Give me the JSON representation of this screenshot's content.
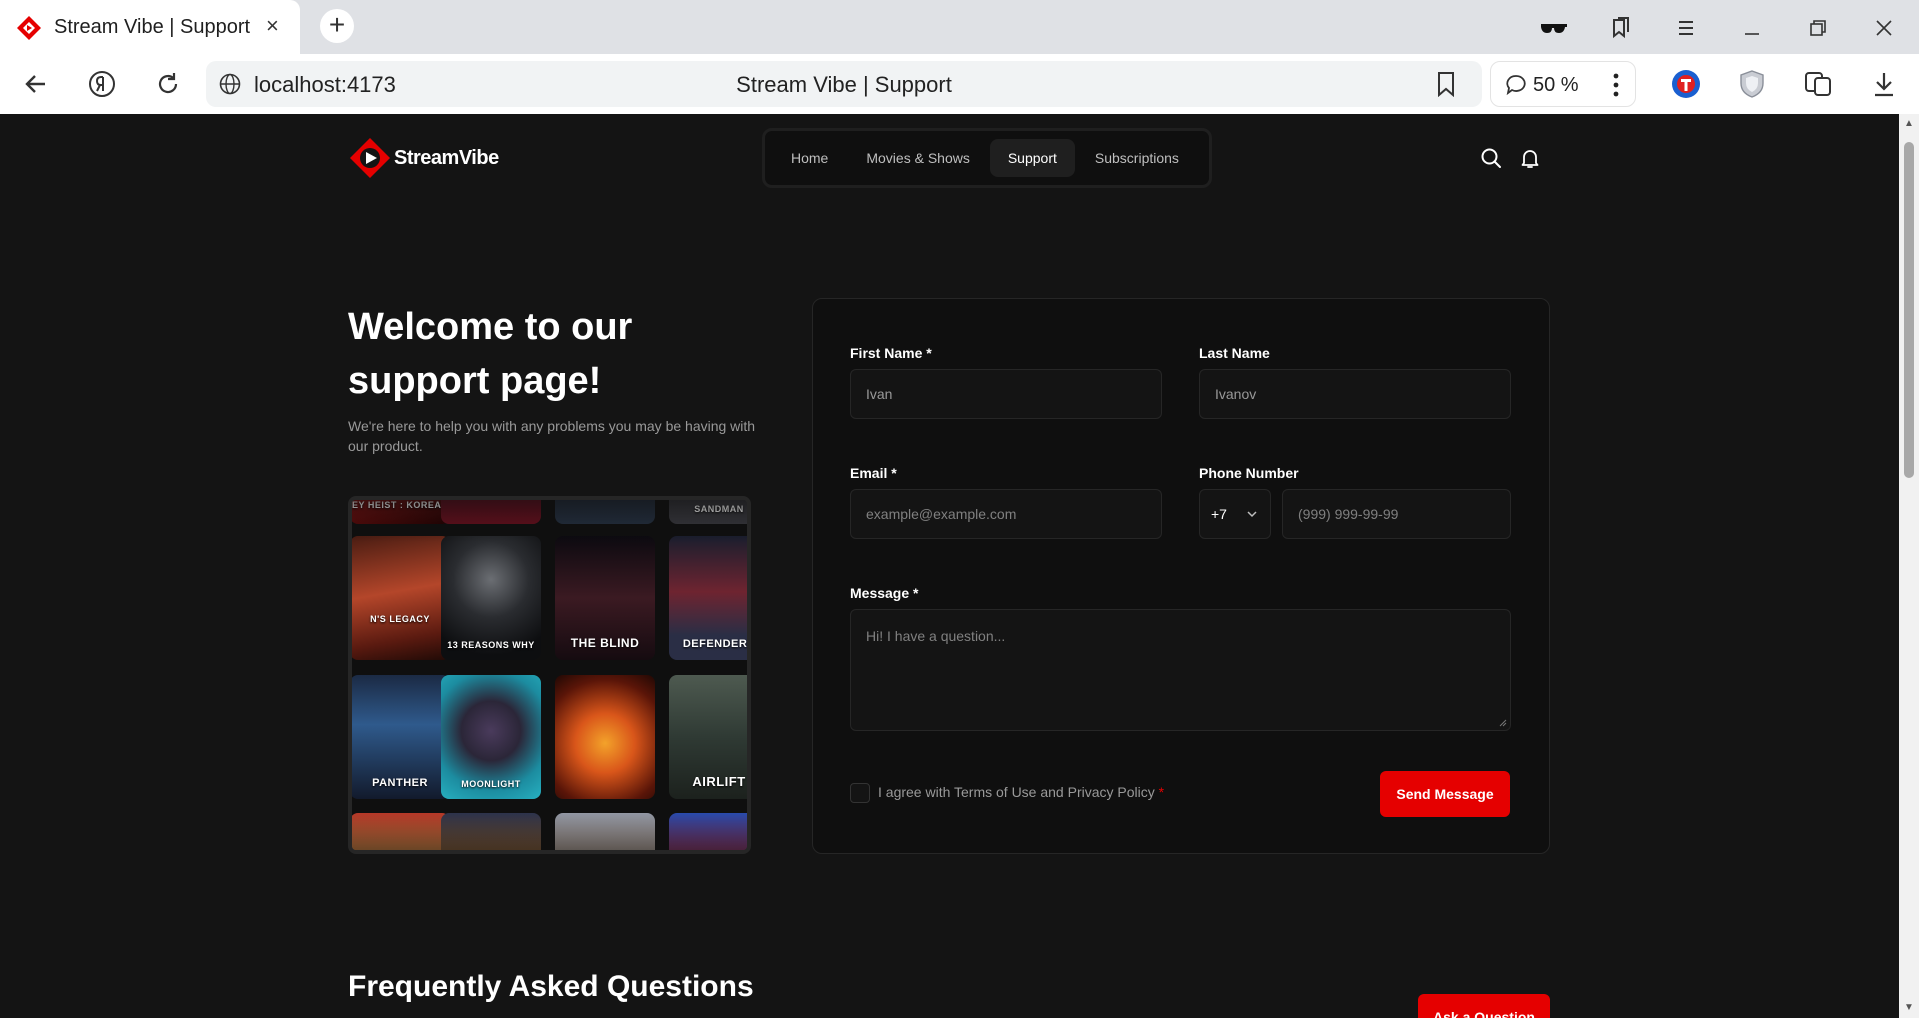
{
  "browser": {
    "tab_title": "Stream Vibe | Support",
    "tab_close": "×",
    "new_tab": "+",
    "url": "localhost:4173",
    "page_title": "Stream Vibe | Support",
    "zoom": "50 %"
  },
  "site": {
    "brand": "StreamVibe",
    "brand_color": "#e50000",
    "nav": [
      {
        "label": "Home"
      },
      {
        "label": "Movies & Shows"
      },
      {
        "label": "Support"
      },
      {
        "label": "Subscriptions"
      }
    ]
  },
  "hero": {
    "title": "Welcome to our support page!",
    "subtitle": "We're here to help you with any problems you may be having with our product."
  },
  "posters": [
    {
      "label": "EY HEIST : KOREA"
    },
    {
      "label": ""
    },
    {
      "label": ""
    },
    {
      "label": "SANDMAN"
    },
    {
      "label": "N'S LEGACY"
    },
    {
      "label": "13 REASONS WHY"
    },
    {
      "label": "THE BLIND"
    },
    {
      "label": "DEFENDERS"
    },
    {
      "label": "PANTHER"
    },
    {
      "label": "MOONLIGHT"
    },
    {
      "label": ""
    },
    {
      "label": "AIRLIFT"
    },
    {
      "label": ""
    },
    {
      "label": ""
    },
    {
      "label": ""
    },
    {
      "label": ""
    }
  ],
  "form": {
    "first_name_label": "First Name",
    "first_name_value": "Ivan",
    "last_name_label": "Last Name",
    "last_name_value": "Ivanov",
    "email_label": "Email",
    "email_placeholder": "example@example.com",
    "phone_label": "Phone Number",
    "country_code": "+7",
    "phone_placeholder": "(999) 999-99-99",
    "message_label": "Message",
    "message_placeholder": "Hi! I have a question...",
    "agree_text": "I agree with Terms of Use and Privacy Policy",
    "required_mark": "*",
    "send_label": "Send Message"
  },
  "faq": {
    "title": "Frequently Asked Questions",
    "ask_label": "Ask a Question"
  }
}
